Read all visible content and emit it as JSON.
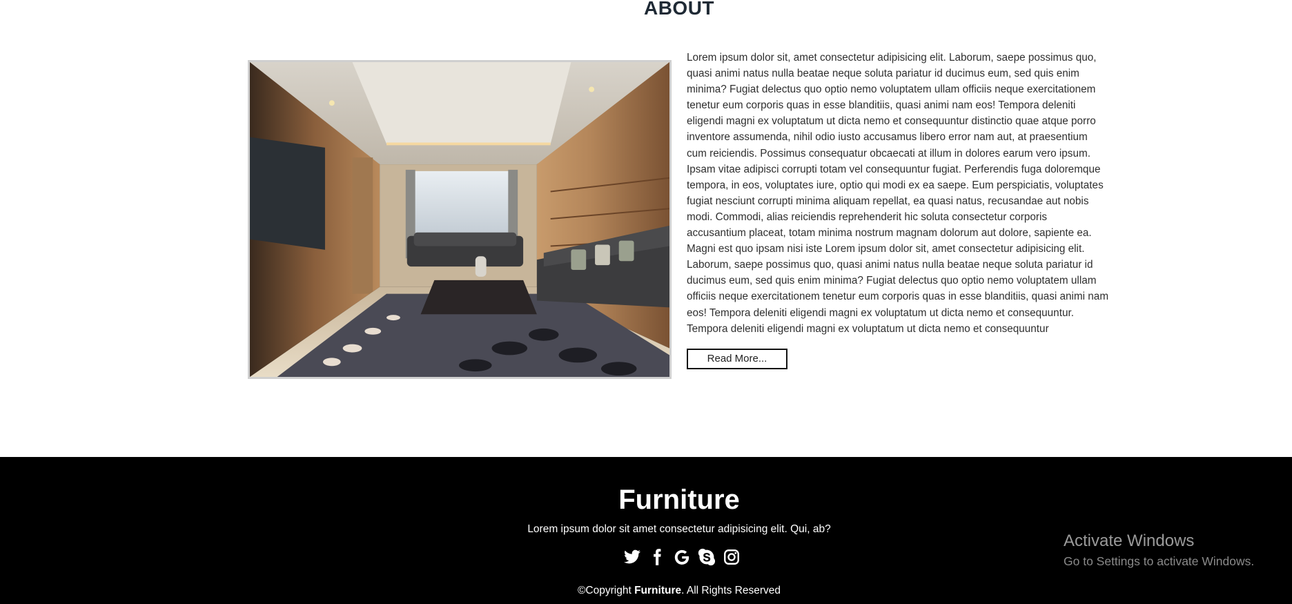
{
  "about": {
    "title": "ABOUT",
    "image_alt": "Living room interior",
    "text": "Lorem ipsum dolor sit, amet consectetur adipisicing elit. Laborum, saepe possimus quo, quasi animi natus nulla beatae neque soluta pariatur id ducimus eum, sed quis enim minima? Fugiat delectus quo optio nemo voluptatem ullam officiis neque exercitationem tenetur eum corporis quas in esse blanditiis, quasi animi nam eos! Tempora deleniti eligendi magni ex voluptatum ut dicta nemo et consequuntur distinctio quae atque porro inventore assumenda, nihil odio iusto accusamus libero error nam aut, at praesentium cum reiciendis. Possimus consequatur obcaecati at illum in dolores earum vero ipsum. Ipsam vitae adipisci corrupti totam vel consequuntur fugiat. Perferendis fuga doloremque tempora, in eos, voluptates iure, optio qui modi ex ea saepe. Eum perspiciatis, voluptates fugiat nesciunt corrupti minima aliquam repellat, ea quasi natus, recusandae aut nobis modi. Commodi, alias reiciendis reprehenderit hic soluta consectetur corporis accusantium placeat, totam minima nostrum magnam dolorum aut dolore, sapiente ea. Magni est quo ipsam nisi iste Lorem ipsum dolor sit, amet consectetur adipisicing elit. Laborum, saepe possimus quo, quasi animi natus nulla beatae neque soluta pariatur id ducimus eum, sed quis enim minima? Fugiat delectus quo optio nemo voluptatem ullam officiis neque exercitationem tenetur eum corporis quas in esse blanditiis, quasi animi nam eos! Tempora deleniti eligendi magni ex voluptatum ut dicta nemo et consequuntur. Tempora deleniti eligendi magni ex voluptatum ut dicta nemo et consequuntur",
    "read_more_label": "Read More..."
  },
  "footer": {
    "brand": "Furniture",
    "tagline": "Lorem ipsum dolor sit amet consectetur adipisicing elit. Qui, ab?",
    "social_icons": [
      "twitter-icon",
      "facebook-icon",
      "google-icon",
      "skype-icon",
      "instagram-icon"
    ],
    "copyright_prefix": "©Copyright ",
    "copyright_brand": "Furniture",
    "copyright_suffix": ". All Rights Reserved"
  },
  "watermark": {
    "title": "Activate Windows",
    "subtitle": "Go to Settings to activate Windows."
  },
  "colors": {
    "footer_bg": "#000000",
    "page_bg": "#ffffff",
    "text": "#2f2f2f",
    "heading": "#1f2a35"
  }
}
